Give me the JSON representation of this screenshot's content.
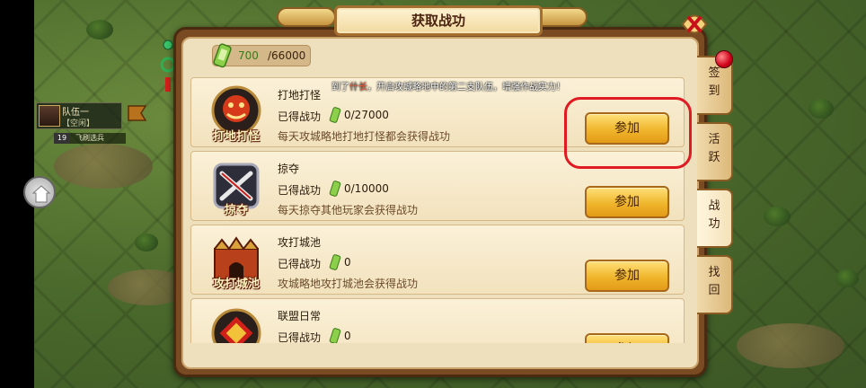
{
  "dialog": {
    "title": "获取战功"
  },
  "currency": {
    "current": "700",
    "max": "/66000"
  },
  "marquee": {
    "prefix": "到了",
    "rank": "什长",
    "suffix": "，开启攻城略地中的第二支队伍，增强作战实力！"
  },
  "hud": {
    "team_name": "队伍一",
    "team_status": "【空闲】",
    "level": "19",
    "soldier": "飞刷选兵"
  },
  "rows": [
    {
      "title": "打地打怪",
      "icon_label": "打地打怪",
      "earned_label": "已得战功",
      "earned": "0/27000",
      "desc": "每天攻城略地打地打怪都会获得战功",
      "button": "参加",
      "icon": "beast-emblem-icon"
    },
    {
      "title": "掠夺",
      "icon_label": "掠夺",
      "earned_label": "已得战功",
      "earned": "0/10000",
      "desc": "每天掠夺其他玩家会获得战功",
      "button": "参加",
      "icon": "crossed-swords-icon"
    },
    {
      "title": "攻打城池",
      "icon_label": "攻打城池",
      "earned_label": "已得战功",
      "earned": "0",
      "desc": "攻城略地攻打城池会获得战功",
      "button": "参加",
      "icon": "castle-gate-icon"
    },
    {
      "title": "联盟日常",
      "icon_label": "",
      "earned_label": "已得战功",
      "earned": "0",
      "desc": "",
      "button": "参加",
      "icon": "alliance-emblem-icon"
    }
  ],
  "tabs": [
    {
      "label": "签到",
      "active": false
    },
    {
      "label": "活跃",
      "active": false
    },
    {
      "label": "战功",
      "active": true
    },
    {
      "label": "找回",
      "active": false
    }
  ],
  "colors": {
    "highlight": "#e01a22",
    "accent_gold": "#f0b62c",
    "panel_brown": "#7a4a22"
  }
}
